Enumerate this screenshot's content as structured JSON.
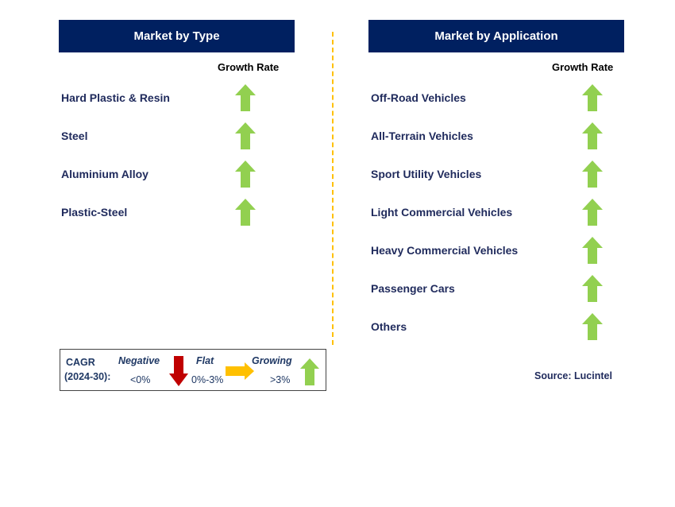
{
  "left": {
    "title": "Market by Type",
    "growth_label": "Growth Rate",
    "items": [
      {
        "label": "Hard Plastic & Resin",
        "trend": "growing"
      },
      {
        "label": "Steel",
        "trend": "growing"
      },
      {
        "label": "Aluminium Alloy",
        "trend": "growing"
      },
      {
        "label": "Plastic-Steel",
        "trend": "growing"
      }
    ]
  },
  "right": {
    "title": "Market by Application",
    "growth_label": "Growth Rate",
    "items": [
      {
        "label": "Off-Road Vehicles",
        "trend": "growing"
      },
      {
        "label": "All-Terrain Vehicles",
        "trend": "growing"
      },
      {
        "label": "Sport Utility Vehicles",
        "trend": "growing"
      },
      {
        "label": "Light Commercial Vehicles",
        "trend": "growing"
      },
      {
        "label": "Heavy Commercial Vehicles",
        "trend": "growing"
      },
      {
        "label": "Passenger Cars",
        "trend": "growing"
      },
      {
        "label": "Others",
        "trend": "growing"
      }
    ]
  },
  "legend": {
    "cagr": "CAGR",
    "period": "(2024-30):",
    "negative": "Negative",
    "negative_range": "<0%",
    "flat": "Flat",
    "flat_range": "0%-3%",
    "growing": "Growing",
    "growing_range": ">3%"
  },
  "source": "Source: Lucintel",
  "colors": {
    "header": "#002060",
    "growing": "#92d050",
    "negative": "#c00000",
    "flat": "#ffc000"
  }
}
